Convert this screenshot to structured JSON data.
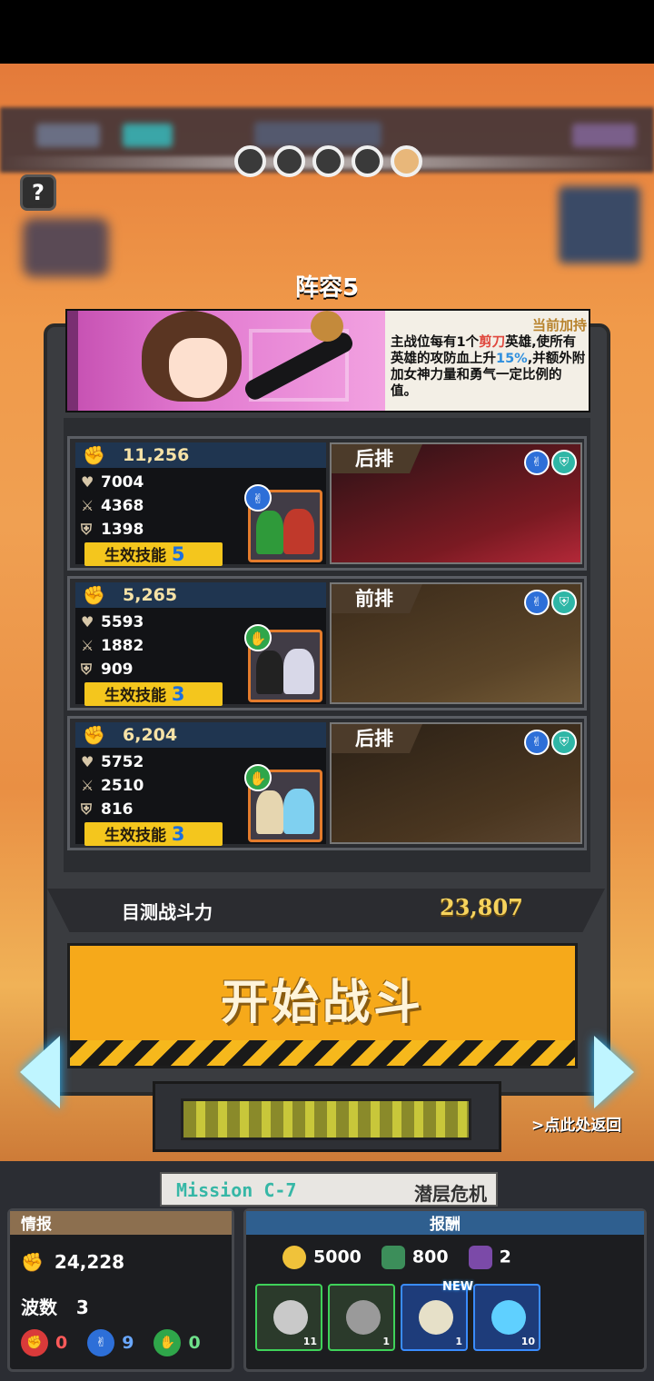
{
  "header": {
    "page_indicator": {
      "total": 5,
      "active_index": 5
    }
  },
  "team": {
    "title": "阵容5"
  },
  "bonus": {
    "heading": "当前加持",
    "text_part1": "主战位每有1个",
    "text_highlight": "剪刀",
    "text_part2": "英雄,使所有英雄的攻防血上升",
    "text_percent": "15%",
    "text_part3": ",并额外附加女神力量和勇气一定比例的值。"
  },
  "cards": [
    {
      "power": "11,256",
      "hp": "7004",
      "atk": "4368",
      "def": "1398",
      "skill_label": "生效技能",
      "skill_count": "5",
      "position": "后排",
      "type": "scissors",
      "type_color": "#2d6fd8",
      "portrait_colors": [
        "#2f9a3a",
        "#c0392b"
      ]
    },
    {
      "power": "5,265",
      "hp": "5593",
      "atk": "1882",
      "def": "909",
      "skill_label": "生效技能",
      "skill_count": "3",
      "position": "前排",
      "type": "paper",
      "type_color": "#2fa64a",
      "portrait_colors": [
        "#222222",
        "#d8d8e8"
      ]
    },
    {
      "power": "6,204",
      "hp": "5752",
      "atk": "2510",
      "def": "816",
      "skill_label": "生效技能",
      "skill_count": "3",
      "position": "后排",
      "type": "paper",
      "type_color": "#2fa64a",
      "portrait_colors": [
        "#e6d6b0",
        "#7fd0f0"
      ]
    }
  ],
  "summary": {
    "label": "目测战斗力",
    "value": "23,807"
  },
  "start_button": {
    "label": "开始战斗"
  },
  "back_link": ">点此处返回",
  "mission": {
    "code": "Mission  C-7",
    "name": "潜层危机"
  },
  "info": {
    "heading": "情报",
    "power": "24,228",
    "waves_label": "波数",
    "waves": "3",
    "rock": "0",
    "scissors": "9",
    "paper": "0"
  },
  "reward": {
    "heading": "报酬",
    "gold": "5000",
    "book": "800",
    "ticket": "2",
    "items": [
      {
        "qty": "11",
        "color": "#3fd25a"
      },
      {
        "qty": "1",
        "color": "#3fd25a"
      },
      {
        "qty": "1",
        "color": "#3a8cff",
        "badge": "NEW"
      },
      {
        "qty": "10",
        "color": "#3a8cff"
      }
    ]
  },
  "colors": {
    "accent": "#f6a91a",
    "gold": "#f6d35d",
    "cyan": "#bff5ff"
  }
}
